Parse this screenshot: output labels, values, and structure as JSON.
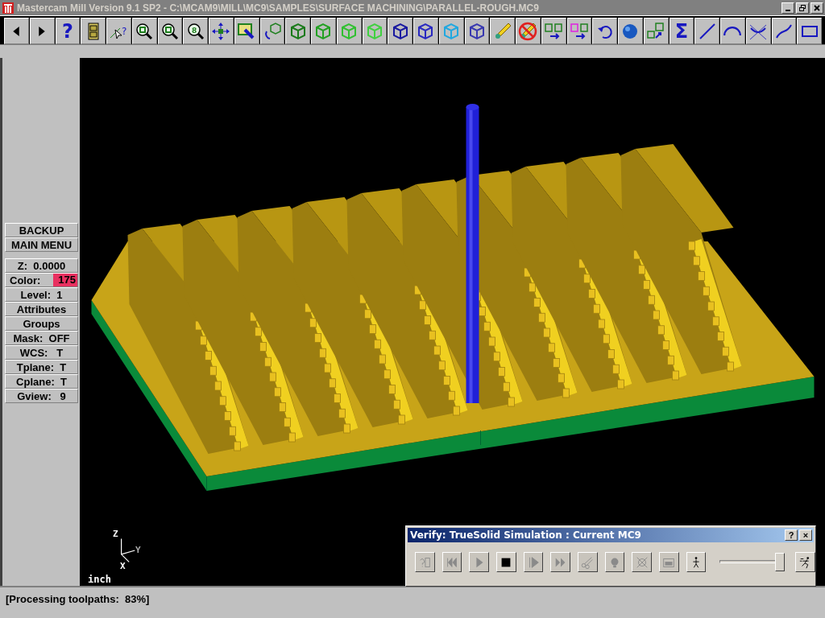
{
  "window": {
    "title": "Mastercam Mill Version 9.1 SP2 - C:\\MCAM9\\MILL\\MC9\\SAMPLES\\SURFACE MACHINING\\PARALLEL-ROUGH.MC9"
  },
  "toolbar": [
    {
      "kind": "arrow-left"
    },
    {
      "kind": "arrow-right"
    },
    {
      "kind": "text",
      "label": "?"
    },
    {
      "kind": "cabinet"
    },
    {
      "kind": "pointer-help",
      "label": "?"
    },
    {
      "kind": "zoom-window"
    },
    {
      "kind": "zoom"
    },
    {
      "kind": "zoom-text",
      "label": "8"
    },
    {
      "kind": "pan"
    },
    {
      "kind": "brush"
    },
    {
      "kind": "rotate-cube"
    },
    {
      "kind": "cube",
      "color": "#1a7a1a"
    },
    {
      "kind": "cube",
      "color": "#22a022"
    },
    {
      "kind": "cube",
      "color": "#30c030"
    },
    {
      "kind": "cube",
      "color": "#40d040"
    },
    {
      "kind": "cube",
      "color": "#1818a0"
    },
    {
      "kind": "cube",
      "color": "#2828c0"
    },
    {
      "kind": "cube",
      "color": "#20a8e0"
    },
    {
      "kind": "cube",
      "color": "#3838b0"
    },
    {
      "kind": "pencil"
    },
    {
      "kind": "pencil-no"
    },
    {
      "kind": "copy"
    },
    {
      "kind": "copy-multi"
    },
    {
      "kind": "undo"
    },
    {
      "kind": "sphere"
    },
    {
      "kind": "cubes-arrow"
    },
    {
      "kind": "text",
      "label": "Σ"
    },
    {
      "kind": "line"
    },
    {
      "kind": "arc"
    },
    {
      "kind": "fillet"
    },
    {
      "kind": "spline"
    },
    {
      "kind": "rectangle"
    }
  ],
  "sidebar": {
    "sections": [
      {
        "items": [
          {
            "label": "BACKUP"
          },
          {
            "label": "MAIN MENU"
          }
        ]
      },
      {
        "items": [
          {
            "label": "Z:  0.0000"
          },
          {
            "label": "Color:",
            "value": "175",
            "color": "#e83060"
          },
          {
            "label": "Level:  1"
          },
          {
            "label": "Attributes"
          },
          {
            "label": "Groups"
          },
          {
            "label": "Mask:  OFF"
          },
          {
            "label": "WCS:   T"
          },
          {
            "label": "Tplane:  T"
          },
          {
            "label": "Cplane:  T"
          },
          {
            "label": "Gview:   9"
          }
        ]
      }
    ]
  },
  "viewport": {
    "axes": {
      "z": "Z",
      "y": "Y",
      "x": "X"
    },
    "units": "inch"
  },
  "verify_dialog": {
    "title": "Verify: TrueSolid Simulation : Current MC9",
    "help": "?",
    "close": "×",
    "buttons": [
      {
        "kind": "help-screen",
        "disabled": true
      },
      {
        "kind": "rewind",
        "disabled": true
      },
      {
        "kind": "play",
        "disabled": true
      },
      {
        "kind": "stop",
        "disabled": false
      },
      {
        "kind": "step",
        "disabled": true
      },
      {
        "kind": "fast-forward",
        "disabled": true
      },
      {
        "kind": "cut",
        "disabled": true
      },
      {
        "kind": "bulb",
        "disabled": true
      },
      {
        "kind": "measure",
        "disabled": true
      },
      {
        "kind": "display",
        "disabled": true
      },
      {
        "kind": "walk",
        "disabled": false
      }
    ],
    "speed": {
      "level": 0.95
    },
    "run_button": {
      "disabled": false
    }
  },
  "status_bar": {
    "text": "[Processing toolpaths:  83%]"
  }
}
